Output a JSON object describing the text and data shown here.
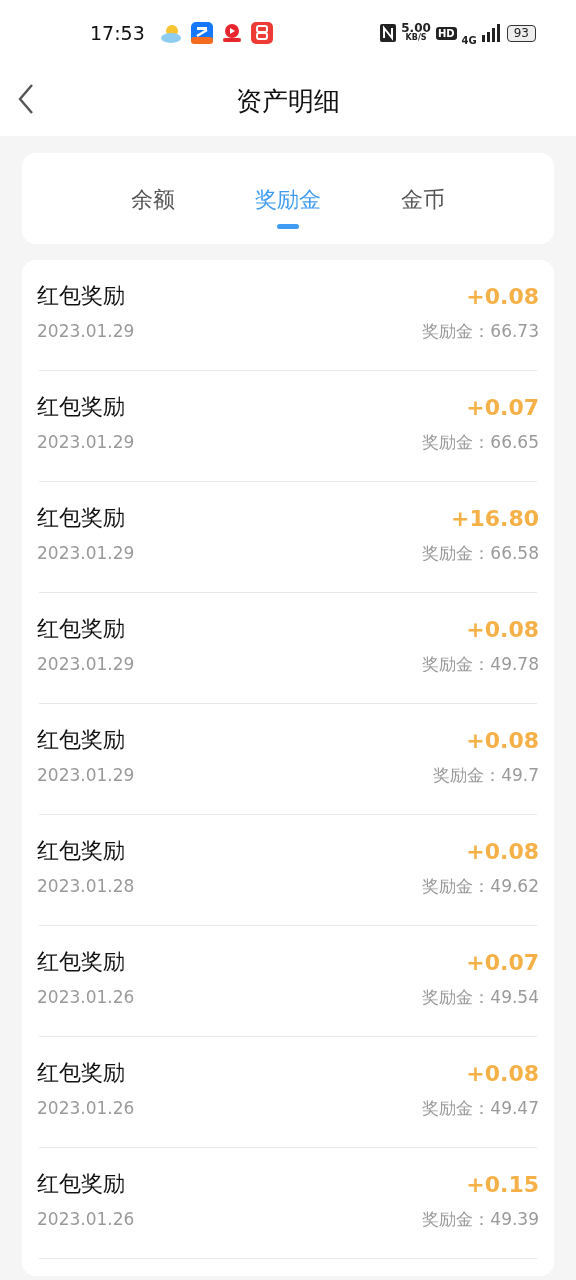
{
  "status_bar": {
    "time": "17:53",
    "speed": "5.00",
    "speed_unit": "KB/S",
    "hd": "HD",
    "network": "4G",
    "battery": "93"
  },
  "header": {
    "title": "资产明细"
  },
  "tabs": [
    {
      "label": "余额",
      "selected": false
    },
    {
      "label": "奖励金",
      "selected": true
    },
    {
      "label": "金币",
      "selected": false
    }
  ],
  "records": [
    {
      "title": "红包奖励",
      "date": "2023.01.29",
      "amount": "+0.08",
      "balance": "奖励金：66.73"
    },
    {
      "title": "红包奖励",
      "date": "2023.01.29",
      "amount": "+0.07",
      "balance": "奖励金：66.65"
    },
    {
      "title": "红包奖励",
      "date": "2023.01.29",
      "amount": "+16.80",
      "balance": "奖励金：66.58"
    },
    {
      "title": "红包奖励",
      "date": "2023.01.29",
      "amount": "+0.08",
      "balance": "奖励金：49.78"
    },
    {
      "title": "红包奖励",
      "date": "2023.01.29",
      "amount": "+0.08",
      "balance": "奖励金：49.7"
    },
    {
      "title": "红包奖励",
      "date": "2023.01.28",
      "amount": "+0.08",
      "balance": "奖励金：49.62"
    },
    {
      "title": "红包奖励",
      "date": "2023.01.26",
      "amount": "+0.07",
      "balance": "奖励金：49.54"
    },
    {
      "title": "红包奖励",
      "date": "2023.01.26",
      "amount": "+0.08",
      "balance": "奖励金：49.47"
    },
    {
      "title": "红包奖励",
      "date": "2023.01.26",
      "amount": "+0.15",
      "balance": "奖励金：49.39"
    }
  ]
}
